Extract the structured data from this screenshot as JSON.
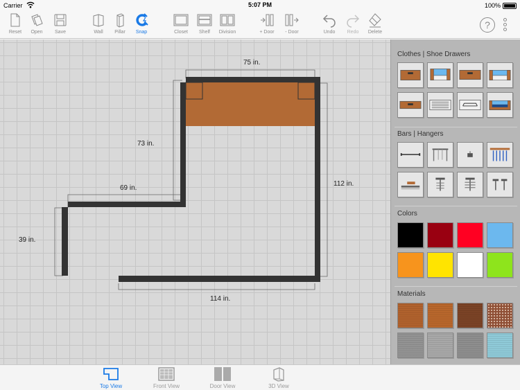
{
  "status": {
    "carrier": "Carrier",
    "time": "5:07 PM",
    "battery": "100%"
  },
  "toolbar": {
    "reset": "Reset",
    "open": "Open",
    "save": "Save",
    "wall": "Wall",
    "pillar": "Pillar",
    "snap": "Snap",
    "closet": "Closet",
    "shelf": "Shelf",
    "division": "Division",
    "add_door": "+ Door",
    "remove_door": "- Door",
    "undo": "Undo",
    "redo": "Redo",
    "delete": "Delete",
    "help": "?"
  },
  "dimensions": {
    "top": "75 in.",
    "left_upper": "73 in.",
    "middle": "69 in.",
    "right": "112 in.",
    "left_lower": "39 in.",
    "bottom": "114 in."
  },
  "panel": {
    "sections": {
      "drawers": "Clothes | Shoe Drawers",
      "bars": "Bars | Hangers",
      "colors": "Colors",
      "materials": "Materials"
    },
    "colors": [
      "#000000",
      "#990011",
      "#ff0022",
      "#6cb8ee",
      "#f7941d",
      "#ffe400",
      "#ffffff",
      "#8ee41c"
    ],
    "materials": [
      "#b1622d",
      "#b9672c",
      "#7b4326",
      "#8f4f35",
      "#939393",
      "#a8a8a8",
      "#8e8e8e",
      "#8fcad8"
    ]
  },
  "tabs": {
    "top": "Top View",
    "front": "Front View",
    "door": "Door View",
    "three_d": "3D View"
  },
  "accent": "#1a7ae6",
  "wall_color": "#333333",
  "closet_fill": "#b26a35"
}
